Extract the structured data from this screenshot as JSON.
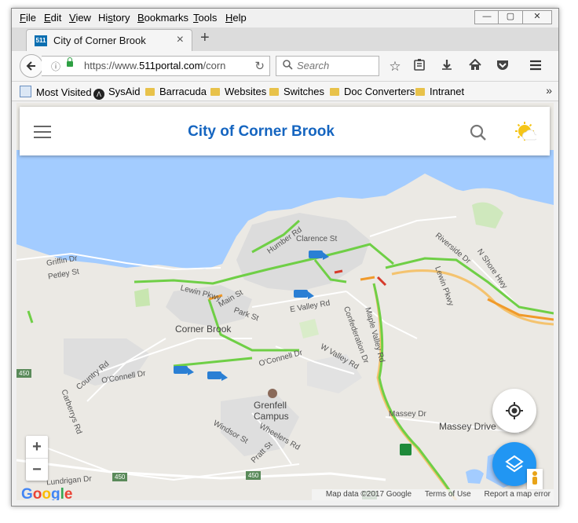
{
  "window": {
    "menu": [
      "File",
      "Edit",
      "View",
      "History",
      "Bookmarks",
      "Tools",
      "Help"
    ],
    "menu_accel": [
      "F",
      "E",
      "V",
      "s",
      "B",
      "T",
      "H"
    ],
    "controls": {
      "minimize": "—",
      "restore": "▢",
      "close": "✕"
    }
  },
  "tab": {
    "favicon_text": "511",
    "title": "City of Corner Brook"
  },
  "navbar": {
    "url_prefix": "https://www.",
    "url_domain": "511portal.com",
    "url_rest": "/corn",
    "search_placeholder": "Search"
  },
  "bookmarks": {
    "most_visited": "Most Visited",
    "items": [
      "SysAid",
      "Barracuda",
      "Websites",
      "Switches",
      "Doc Converters",
      "Intranet"
    ]
  },
  "app": {
    "title": "City of Corner Brook"
  },
  "map": {
    "labels": {
      "corner_brook": "Corner Brook",
      "grenfell": "Grenfell",
      "campus": "Campus",
      "massey_drive": "Massey Drive",
      "clarence": "Clarence St",
      "humber": "Humber Rd",
      "riverside": "Riverside Dr",
      "n_shore": "N Shore Hwy",
      "griffin": "Griffin Dr",
      "petley": "Petley St",
      "lewin_pkwy": "Lewin Pkwy",
      "lewin_pkwy2": "Lewin Pkwy",
      "main_st": "Main St",
      "park_st": "Park St",
      "e_valley": "E Valley Rd",
      "maple_valley": "Maple Valley Rd",
      "confederation": "Confederation Dr",
      "w_valley": "W Valley Rd",
      "oconnell": "O'Connell Dr",
      "oconnell2": "O'Connell Dr",
      "country_rd": "Country Rd",
      "carberrys": "Carberrys Rd",
      "windsor": "Windsor St",
      "wheelers": "Wheelers Rd",
      "pratt": "Pratt St",
      "lundrigan": "Lundrigan Dr",
      "massey_dr": "Massey Dr",
      "shield_450a": "450",
      "shield_450b": "450",
      "shield_450c": "450",
      "shield_450d": "450"
    },
    "zoom_in": "+",
    "zoom_out": "−",
    "google_letters": [
      "G",
      "o",
      "o",
      "g",
      "l",
      "e"
    ],
    "google_colors": [
      "#4285F4",
      "#EA4335",
      "#FBBC05",
      "#4285F4",
      "#34A853",
      "#EA4335"
    ],
    "attribution": {
      "data": "Map data ©2017 Google",
      "terms": "Terms of Use",
      "report": "Report a map error"
    }
  },
  "colors": {
    "water": "#a3ccff",
    "land": "#ebe9e4",
    "urban": "#dcdcdc",
    "traffic_green": "#6fcf46",
    "traffic_orange": "#f09a2a",
    "traffic_red": "#d63a2a",
    "highway": "#f4c36f",
    "accent_blue": "#2196f3",
    "title_blue": "#1565c0"
  },
  "icons": {
    "menu": "hamburger-icon",
    "search": "search-icon",
    "weather": "weather-sun-cloud-icon",
    "locate": "my-location-icon",
    "layers": "layers-icon",
    "pegman": "street-view-pegman-icon",
    "plow": "snowplow-truck-icon"
  }
}
